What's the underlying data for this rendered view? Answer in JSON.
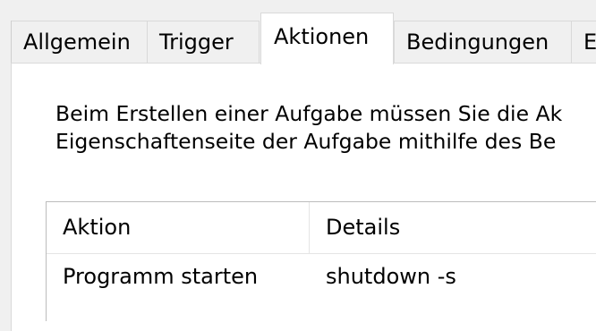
{
  "tabs": [
    {
      "label": "Allgemein"
    },
    {
      "label": "Trigger"
    },
    {
      "label": "Aktionen"
    },
    {
      "label": "Bedingungen"
    },
    {
      "label": "E"
    }
  ],
  "active_tab": "Aktionen",
  "description": {
    "line1": "Beim Erstellen einer Aufgabe müssen Sie die Ak",
    "line2": "Eigenschaftenseite der Aufgabe mithilfe des Be"
  },
  "actions_table": {
    "columns": [
      "Aktion",
      "Details"
    ],
    "rows": [
      [
        "Programm starten",
        "shutdown -s"
      ]
    ]
  }
}
